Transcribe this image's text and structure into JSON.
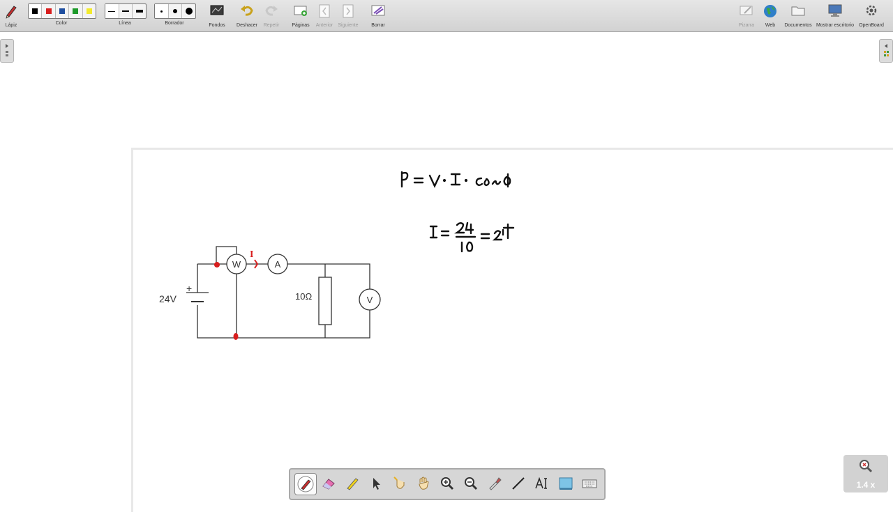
{
  "toolbar": {
    "pen": "Lápiz",
    "color": "Color",
    "line": "Línea",
    "eraser": "Borrador",
    "backgrounds": "Fondos",
    "undo": "Deshacer",
    "redo": "Repetir",
    "pages": "Páginas",
    "previous": "Anterior",
    "next": "Siguiente",
    "clear": "Borrar",
    "board": "Pizarra",
    "web": "Web",
    "documents": "Documentos",
    "desktop": "Mostrar escritorio",
    "openboard": "OpenBoard"
  },
  "colors": [
    "#000000",
    "#d81e1e",
    "#1f4fa0",
    "#1e9a2b",
    "#f2ea2c"
  ],
  "circuit": {
    "voltage": "24V",
    "plus": "+",
    "resistor": "10Ω",
    "wattmeter": "W",
    "ammeter": "A",
    "voltmeter": "V",
    "current": "I"
  },
  "zoom": {
    "value": "1.4 x"
  },
  "bottom_tools": [
    "pen-icon",
    "eraser-icon",
    "marker-icon",
    "pointer-icon",
    "laser-icon",
    "hand-icon",
    "zoom-in-icon",
    "zoom-out-icon",
    "pipette-icon",
    "line-icon",
    "text-icon",
    "capture-icon",
    "keyboard-icon"
  ]
}
